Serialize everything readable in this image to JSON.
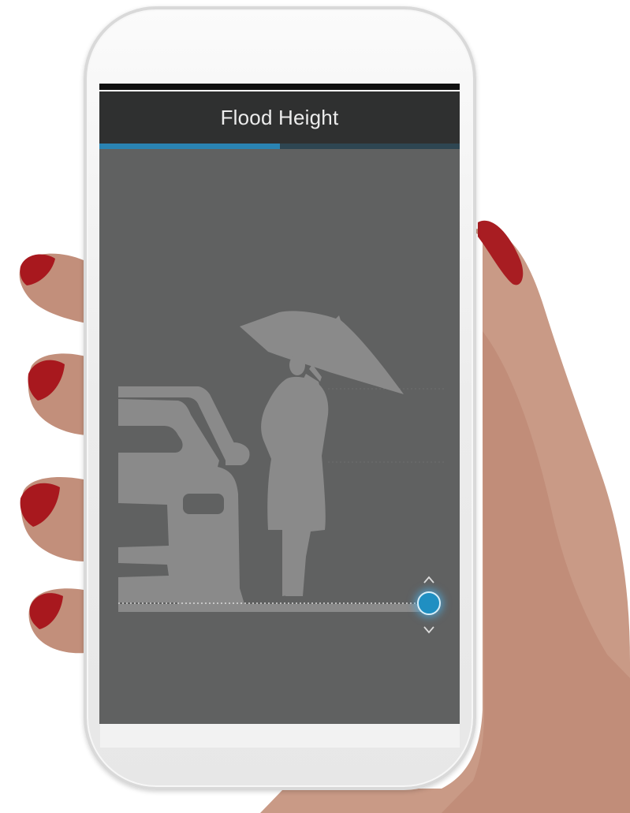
{
  "app": {
    "title": "Flood Height"
  },
  "progress": {
    "step_fraction": 0.5
  },
  "flood_slider": {
    "level_fraction": 0.0,
    "up_icon": "chevron-up-icon",
    "down_icon": "chevron-down-icon"
  },
  "illustration": {
    "icons": [
      "car-silhouette",
      "person-with-umbrella-silhouette"
    ]
  },
  "colors": {
    "screen_bg": "#606161",
    "header_bg": "#2f3030",
    "accent": "#2a83b2",
    "silhouette": "#8a8a8a"
  }
}
